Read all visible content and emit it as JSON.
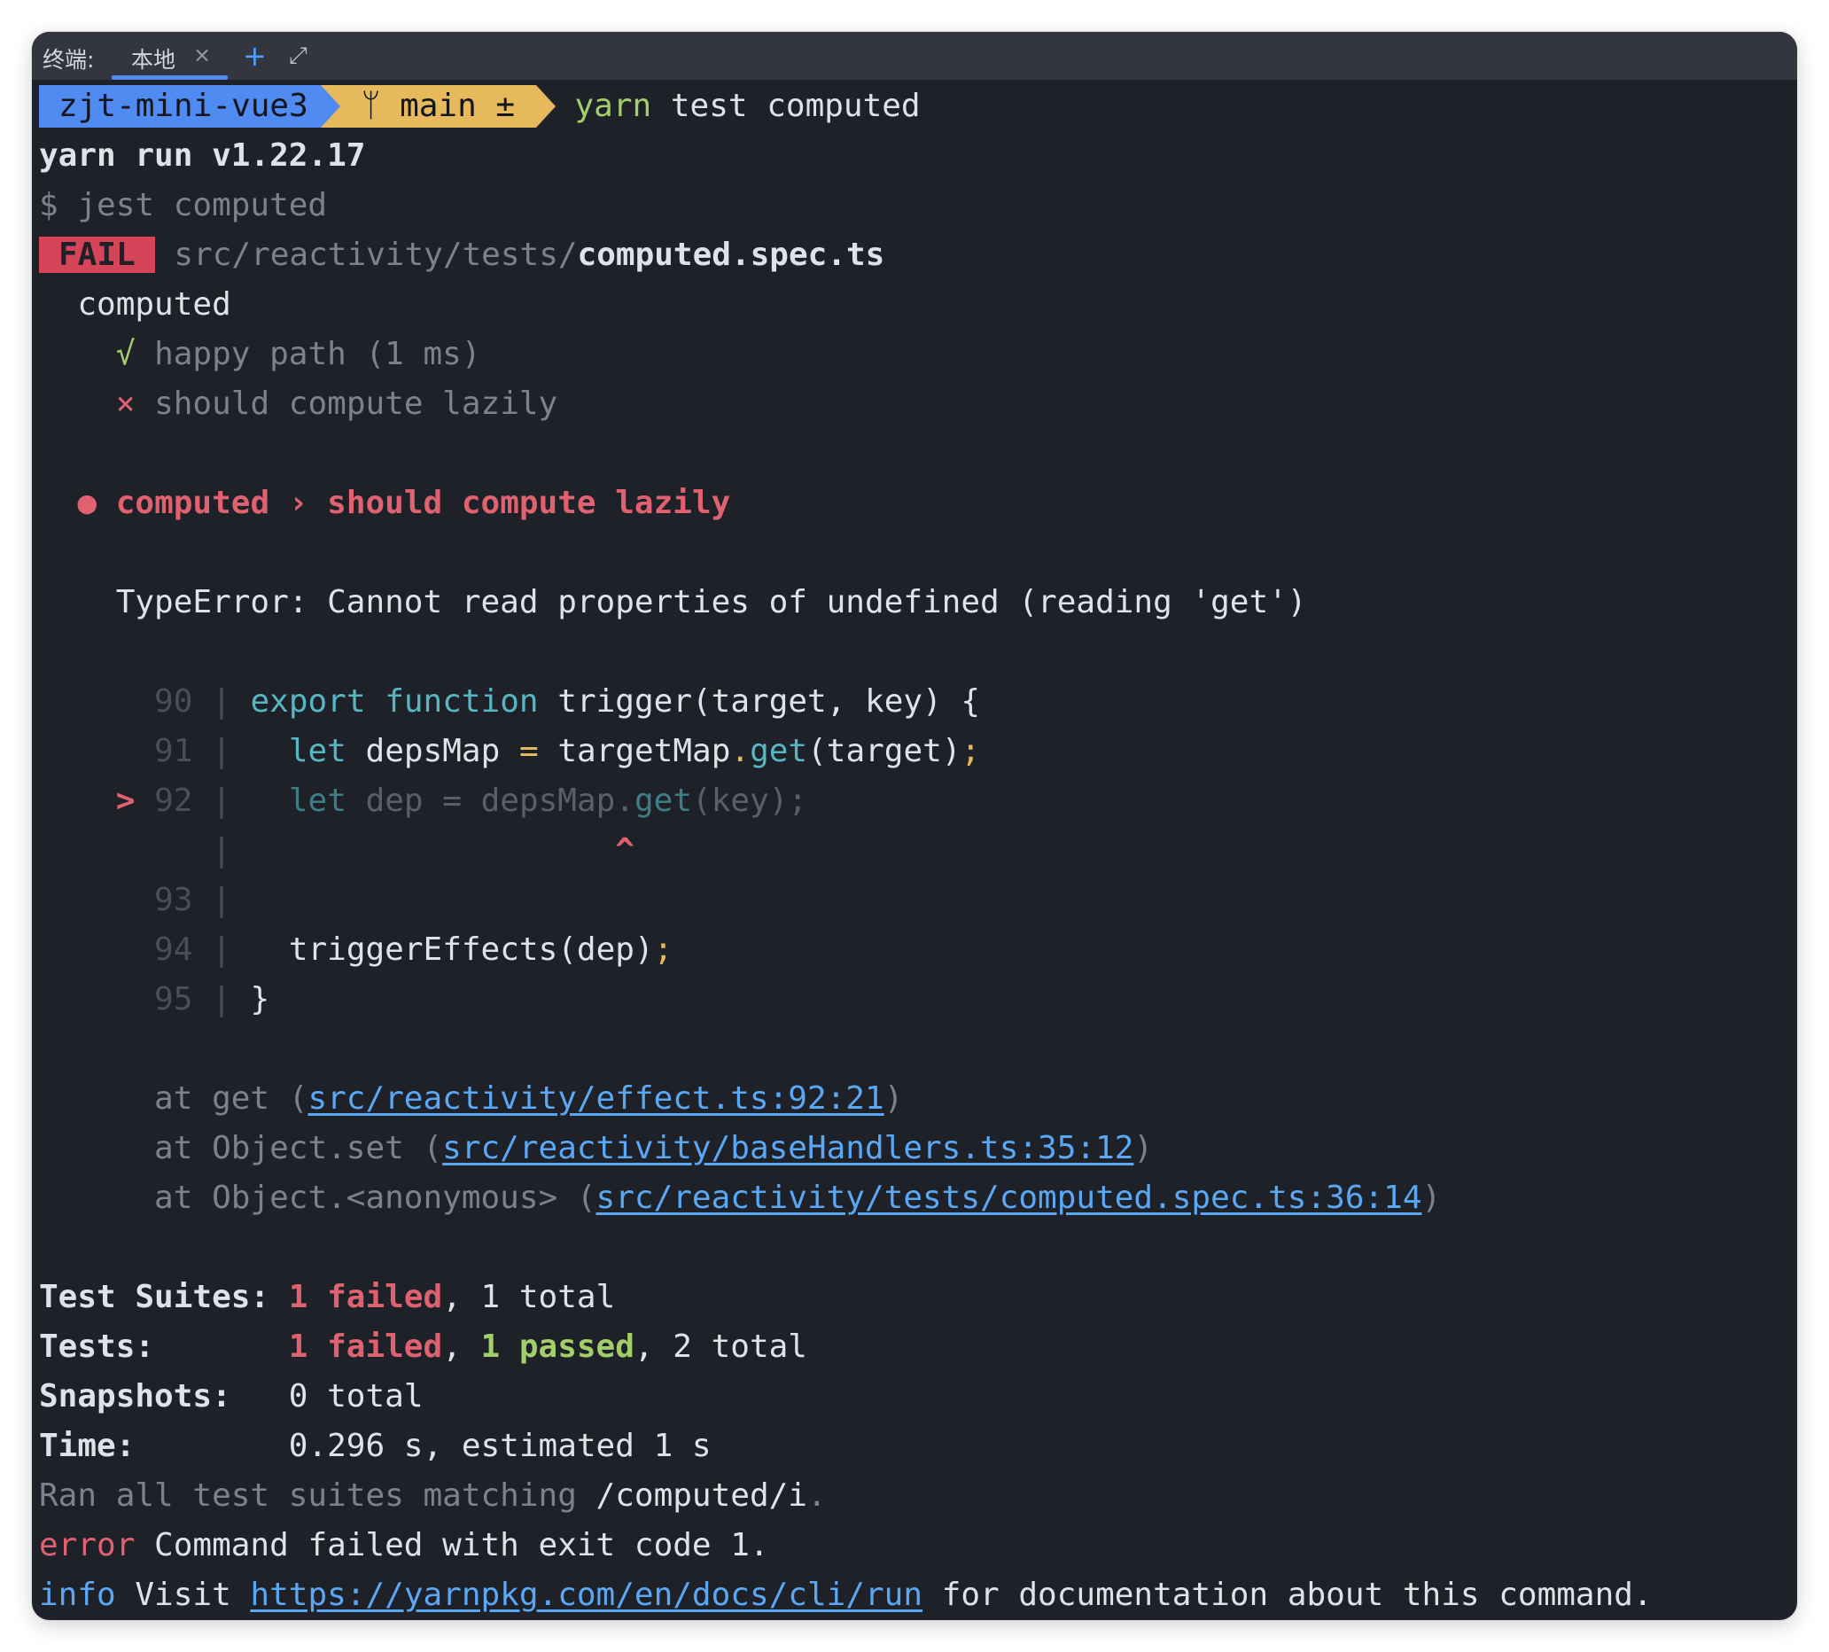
{
  "titlebar": {
    "label": "终端:",
    "tab_label": "本地",
    "tab_close": "×",
    "new_tab": "+",
    "expand": "⤢"
  },
  "prompt": {
    "dir": "zjt-mini-vue3",
    "branch_icon": "ᛘ",
    "branch": "main ±",
    "cmd_word": "yarn",
    "cmd_rest": " test computed"
  },
  "lines": {
    "yarn_run": "yarn run v1.22.17",
    "jest_cmd": "$ jest computed",
    "fail_badge": "FAIL",
    "file_dir": "src/reactivity/tests/",
    "file_name": "computed.spec.ts",
    "describe": "computed",
    "pass_mark": "√",
    "pass_test": "happy path (1 ms)",
    "fail_mark": "×",
    "fail_test": "should compute lazily",
    "bullet": "●",
    "error_title": "computed › should compute lazily",
    "type_error": "TypeError: Cannot read properties of undefined (reading 'get')"
  },
  "code": {
    "pointer": ">",
    "caret": "^",
    "bar": "|",
    "l90_num": "90",
    "l91_num": "91",
    "l92_num": "92",
    "l93_num": "93",
    "l94_num": "94",
    "l95_num": "95",
    "l90_kw1": "export",
    "l90_kw2": "function",
    "l90_rest": "trigger(target, key) {",
    "l91_kw": "let",
    "l91_a": "depsMap",
    "l91_eq": "=",
    "l91_b": "targetMap",
    "l91_dot": ".",
    "l91_get": "get",
    "l91_c": "(target)",
    "l91_semi": ";",
    "l92_kw": "let",
    "l92_rest": "dep = depsMap.",
    "l92_get": "get",
    "l92_end": "(key);",
    "l94_a": "triggerEffects(dep)",
    "l94_semi": ";",
    "l95": "}"
  },
  "stack": [
    {
      "prefix": "at get (",
      "link": "src/reactivity/effect.ts:92:21",
      "suffix": ")"
    },
    {
      "prefix": "at Object.set (",
      "link": "src/reactivity/baseHandlers.ts:35:12",
      "suffix": ")"
    },
    {
      "prefix": "at Object.<anonymous> (",
      "link": "src/reactivity/tests/computed.spec.ts:36:14",
      "suffix": ")"
    }
  ],
  "summary": {
    "suites_label": "Test Suites:",
    "suites_failed": "1 failed",
    "suites_rest": ", 1 total",
    "tests_label": "Tests:",
    "tests_failed": "1 failed",
    "tests_sep": ", ",
    "tests_passed": "1 passed",
    "tests_rest": ", 2 total",
    "snap_label": "Snapshots:",
    "snap_value": "0 total",
    "time_label": "Time:",
    "time_value": "0.296 s, estimated 1 s",
    "ran_prefix": "Ran all test suites matching ",
    "ran_pattern": "/computed/i",
    "ran_dot": "."
  },
  "footer": {
    "error_word": "error",
    "error_msg": " Command failed with exit code 1.",
    "info_word": "info",
    "info_visit": " Visit ",
    "info_link": "https://yarnpkg.com/en/docs/cli/run",
    "info_rest": " for documentation about this command."
  }
}
